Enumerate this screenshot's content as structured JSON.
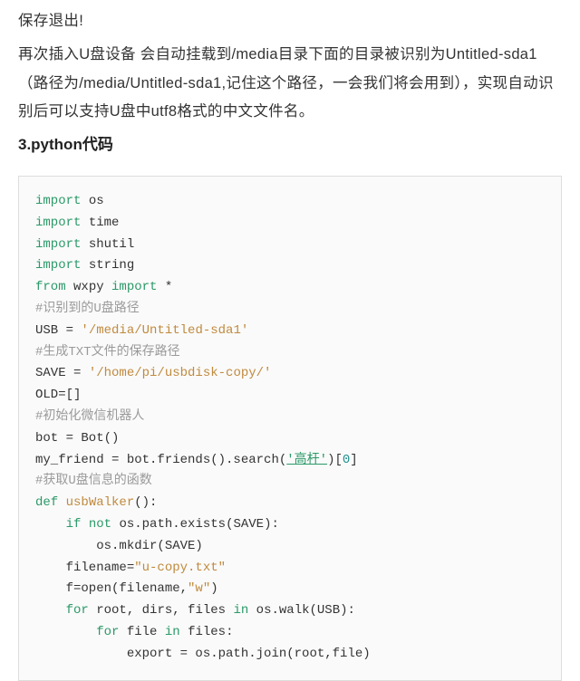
{
  "para1": "保存退出!",
  "para2": "再次插入U盘设备 会自动挂载到/media目录下面的目录被识别为Untitled-sda1（路径为/media/Untitled-sda1,记住这个路径，一会我们将会用到），实现自动识别后可以支持U盘中utf8格式的中文文件名。",
  "heading": "3.python代码",
  "code": {
    "l1a": "import",
    "l1b": " os",
    "l2a": "import",
    "l2b": " time",
    "l3a": "import",
    "l3b": " shutil",
    "l4a": "import",
    "l4b": " string",
    "l5a": "from",
    "l5b": " wxpy ",
    "l5c": "import",
    "l5d": " *",
    "l6": "#识别到的U盘路径",
    "l7a": "USB = ",
    "l7b": "'/media/Untitled-sda1'",
    "l8": "#生成TXT文件的保存路径",
    "l9a": "SAVE = ",
    "l9b": "'/home/pi/usbdisk-copy/'",
    "l10": "OLD=[]",
    "l11": "#初始化微信机器人",
    "l12": "bot = Bot()",
    "l13a": "my_friend = bot.friends().search(",
    "l13b": "'高杆'",
    "l13c": ")[",
    "l13d": "0",
    "l13e": "]",
    "l14": "#获取U盘信息的函数",
    "l15a": "def",
    "l15b": " ",
    "l15c": "usbWalker",
    "l15d": "():",
    "l16a": "    ",
    "l16b": "if",
    "l16c": " ",
    "l16d": "not",
    "l16e": " os.path.exists(SAVE):",
    "l17": "        os.mkdir(SAVE)",
    "l18a": "    filename=",
    "l18b": "\"u-copy.txt\"",
    "l19a": "    f=open(filename,",
    "l19b": "\"w\"",
    "l19c": ")",
    "l20a": "    ",
    "l20b": "for",
    "l20c": " root, dirs, files ",
    "l20d": "in",
    "l20e": " os.walk(USB):",
    "l21a": "        ",
    "l21b": "for",
    "l21c": " file ",
    "l21d": "in",
    "l21e": " files:",
    "l22": "            export = os.path.join(root,file)"
  }
}
